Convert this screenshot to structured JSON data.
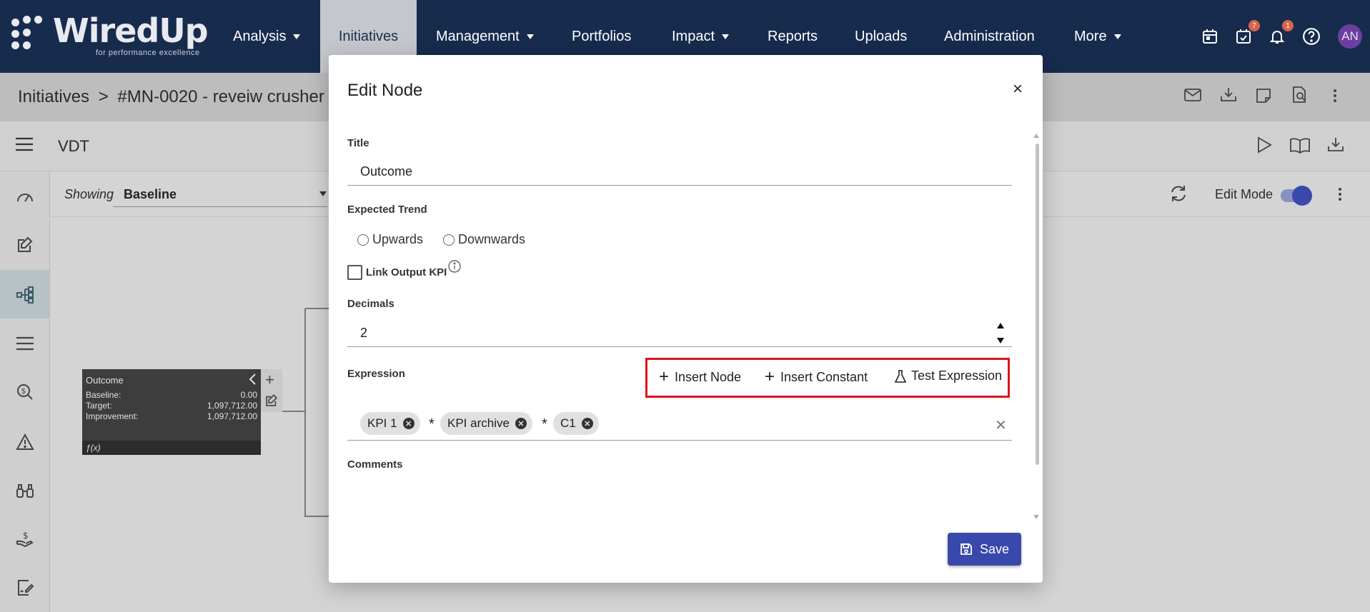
{
  "app": {
    "logo_text": "WiredUp",
    "logo_tagline": "for performance excellence"
  },
  "nav": {
    "items": [
      {
        "label": "Analysis",
        "has_dropdown": true
      },
      {
        "label": "Initiatives",
        "active": true
      },
      {
        "label": "Management",
        "has_dropdown": true
      },
      {
        "label": "Portfolios"
      },
      {
        "label": "Impact",
        "has_dropdown": true
      },
      {
        "label": "Reports"
      },
      {
        "label": "Uploads"
      },
      {
        "label": "Administration"
      },
      {
        "label": "More",
        "has_dropdown": true
      }
    ],
    "icons": [
      "calendar-icon",
      "tasks-icon",
      "bell-icon",
      "help-icon"
    ],
    "badges": {
      "tasks": "7",
      "notifications": "1"
    },
    "avatar": "AN"
  },
  "breadcrumb": {
    "root": "Initiatives",
    "separator": ">",
    "current": "#MN-0020 - reveiw crusher"
  },
  "toolbar": {
    "title": "VDT",
    "showing_label": "Showing",
    "showing_value": "Baseline",
    "edit_mode_label": "Edit Mode"
  },
  "node": {
    "title": "Outcome",
    "rows": [
      {
        "label": "Baseline:",
        "value": "0.00"
      },
      {
        "label": "Target:",
        "value": "1,097,712.00"
      },
      {
        "label": "Improvement:",
        "value": "1,097,712.00"
      }
    ],
    "footer": "ƒ(x)"
  },
  "modal": {
    "title": "Edit Node",
    "close_glyph": "×",
    "title_label": "Title",
    "title_value": "Outcome",
    "trend_label": "Expected Trend",
    "trend_options": [
      "Upwards",
      "Downwards"
    ],
    "link_kpi_label": "Link Output KPI",
    "decimals_label": "Decimals",
    "decimals_value": "2",
    "expression_label": "Expression",
    "insert_node": "Insert Node",
    "insert_constant": "Insert Constant",
    "test_expression": "Test Expression",
    "chips": [
      "KPI 1",
      "KPI archive",
      "C1"
    ],
    "operator": "*",
    "comments_label": "Comments",
    "save_label": "Save"
  },
  "colors": {
    "nav_bg": "#172b4d",
    "accent": "#3949ab",
    "highlight_border": "#e0131a"
  }
}
